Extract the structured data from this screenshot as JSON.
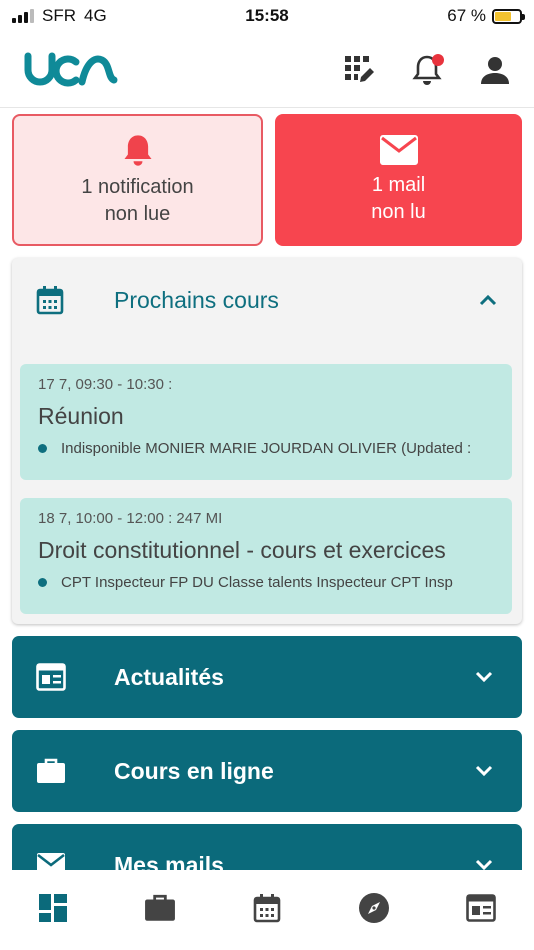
{
  "status_bar": {
    "carrier": "SFR",
    "network": "4G",
    "time": "15:58",
    "battery": "67 %",
    "battery_level": 0.67
  },
  "header": {
    "logo_alt": "uca",
    "icons": [
      "grid-edit-icon",
      "bell-icon",
      "user-icon"
    ],
    "has_unread_notification": true
  },
  "cards": {
    "notifications": {
      "line1": "1 notification",
      "line2": "non lue"
    },
    "mails": {
      "line1": "1 mail",
      "line2": "non lu"
    }
  },
  "prochains_cours": {
    "title": "Prochains cours",
    "expanded": true,
    "items": [
      {
        "when": "17 7, 09:30 - 10:30 :",
        "name": "Réunion",
        "meta": "Indisponible MONIER MARIE JOURDAN OLIVIER (Updated :"
      },
      {
        "when": "18 7, 10:00 - 12:00 : 247 MI",
        "name": "Droit constitutionnel - cours et exercices",
        "meta": "CPT Inspecteur FP DU Classe talents Inspecteur CPT Insp"
      }
    ]
  },
  "sections": [
    {
      "title": "Actualités",
      "icon": "newspaper-icon"
    },
    {
      "title": "Cours en ligne",
      "icon": "briefcase-icon"
    },
    {
      "title": "Mes mails",
      "icon": "mail-icon"
    }
  ],
  "bottom_nav": [
    "dashboard-icon",
    "briefcase-icon",
    "calendar-icon",
    "compass-icon",
    "newspaper-icon"
  ],
  "colors": {
    "teal": "#0b6a7b",
    "teal_text": "#0e6f7f",
    "red": "#f7454f",
    "pink_bg": "#fde6e7",
    "course_bg": "#c1e9e3"
  }
}
